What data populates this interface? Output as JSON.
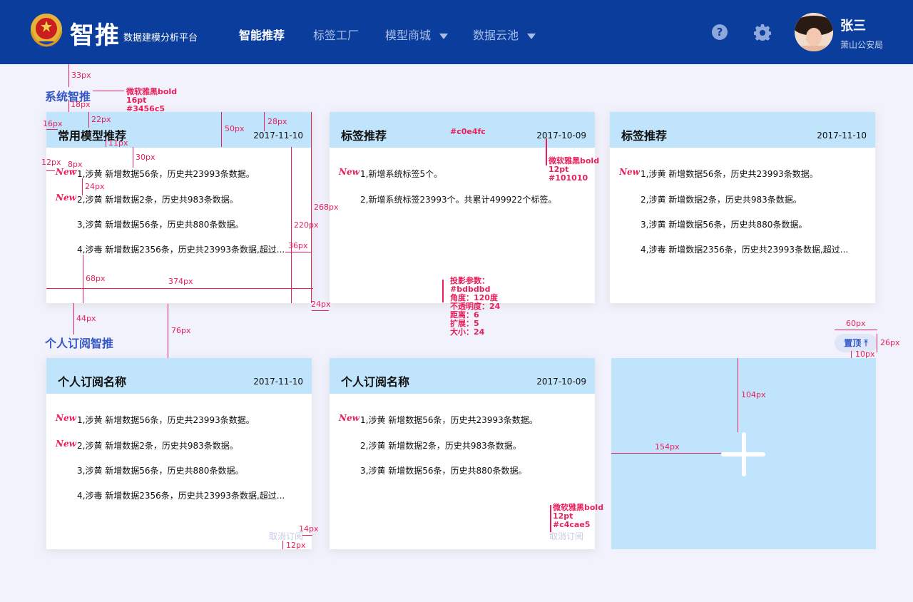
{
  "header": {
    "title": "智推",
    "subtitle": "数据建模分析平台",
    "nav": [
      {
        "label": "智能推荐",
        "active": true
      },
      {
        "label": "标签工厂",
        "active": false
      },
      {
        "label": "模型商城",
        "active": false,
        "dropdown": true
      },
      {
        "label": "数据云池",
        "active": false,
        "dropdown": true
      }
    ],
    "help_icon": "?",
    "user": {
      "name": "张三",
      "org": "萧山公安局"
    }
  },
  "sections": {
    "system": "系统智推",
    "personal": "个人订阅智推"
  },
  "new_tag": "New",
  "system_cards": [
    {
      "title": "常用模型推荐",
      "date": "2017-11-10",
      "rows": [
        {
          "new": true,
          "text": "1,涉黄   新增数据56条，历史共23993条数据。"
        },
        {
          "new": true,
          "text": "2,涉黄   新增数据2条，历史共983条数据。"
        },
        {
          "new": false,
          "text": "3,涉黄   新增数据56条，历史共880条数据。"
        },
        {
          "new": false,
          "text": "4,涉毒   新增数据2356条，历史共23993条数据,超过..."
        }
      ]
    },
    {
      "title": "标签推荐",
      "date": "2017-10-09",
      "rows": [
        {
          "new": true,
          "text": "1,新增系统标签5个。"
        },
        {
          "new": false,
          "text": "2,新增系统标签23993个。共累计499922个标签。"
        }
      ]
    },
    {
      "title": "标签推荐",
      "date": "2017-11-10",
      "rows": [
        {
          "new": true,
          "text": "1,涉黄   新增数据56条，历史共23993条数据。"
        },
        {
          "new": false,
          "text": "2,涉黄   新增数据2条，历史共983条数据。"
        },
        {
          "new": false,
          "text": "3,涉黄   新增数据56条，历史共880条数据。"
        },
        {
          "new": false,
          "text": "4,涉毒   新增数据2356条，历史共23993条数据,超过..."
        }
      ]
    }
  ],
  "personal_cards": [
    {
      "title": "个人订阅名称",
      "date": "2017-11-10",
      "rows": [
        {
          "new": true,
          "text": "1,涉黄   新增数据56条，历史共23993条数据。"
        },
        {
          "new": true,
          "text": "2,涉黄   新增数据2条，历史共983条数据。"
        },
        {
          "new": false,
          "text": "3,涉黄   新增数据56条，历史共880条数据。"
        },
        {
          "new": false,
          "text": "4,涉毒   新增数据2356条，历史共23993条数据,超过..."
        }
      ],
      "unsubscribe": "取消订阅"
    },
    {
      "title": "个人订阅名称",
      "date": "2017-10-09",
      "rows": [
        {
          "new": true,
          "text": "1,涉黄   新增数据56条，历史共23993条数据。"
        },
        {
          "new": false,
          "text": "2,涉黄   新增数据2条，历史共983条数据。"
        },
        {
          "new": false,
          "text": "3,涉黄   新增数据56条，历史共880条数据。"
        }
      ],
      "unsubscribe": "取消订阅"
    }
  ],
  "back_top": "置顶 ⤒",
  "annotations": {
    "title_font": [
      "微软雅黑bold",
      "16pt",
      "#3456c5"
    ],
    "head_color": "#c0e4fc",
    "card_title_font": [
      "微软雅黑bold",
      "12pt",
      "#101010"
    ],
    "shadow": [
      "投影参数：",
      "#bdbdbd",
      "角度：120度",
      "不透明度：24",
      "距离：6",
      "扩展：5",
      "大小：24"
    ],
    "unsub_font": [
      "微软雅黑bold",
      "12pt",
      "#c4cae5"
    ],
    "measures": {
      "m33": "33px",
      "m18": "18px",
      "m16": "16px",
      "m22": "22px",
      "m11": "11px",
      "m50": "50px",
      "m28": "28px",
      "m30": "30px",
      "m12": "12px",
      "m8": "8px",
      "m24": "24px",
      "m220": "220px",
      "m268": "268px",
      "m36": "36px",
      "m68": "68px",
      "m374": "374px",
      "m24b": "24px",
      "m44": "44px",
      "m76": "76px",
      "m60": "60px",
      "m26": "26px",
      "m10": "10px",
      "m104": "104px",
      "m154": "154px",
      "m14": "14px",
      "m12b": "12px"
    }
  },
  "colors": {
    "header_bg": "#0b3d9c",
    "page_bg": "#f2f2fd",
    "card_head": "#c0e4fc",
    "accent": "#3456c5",
    "annotation": "#e8205a",
    "unsub": "#c4cae5"
  }
}
